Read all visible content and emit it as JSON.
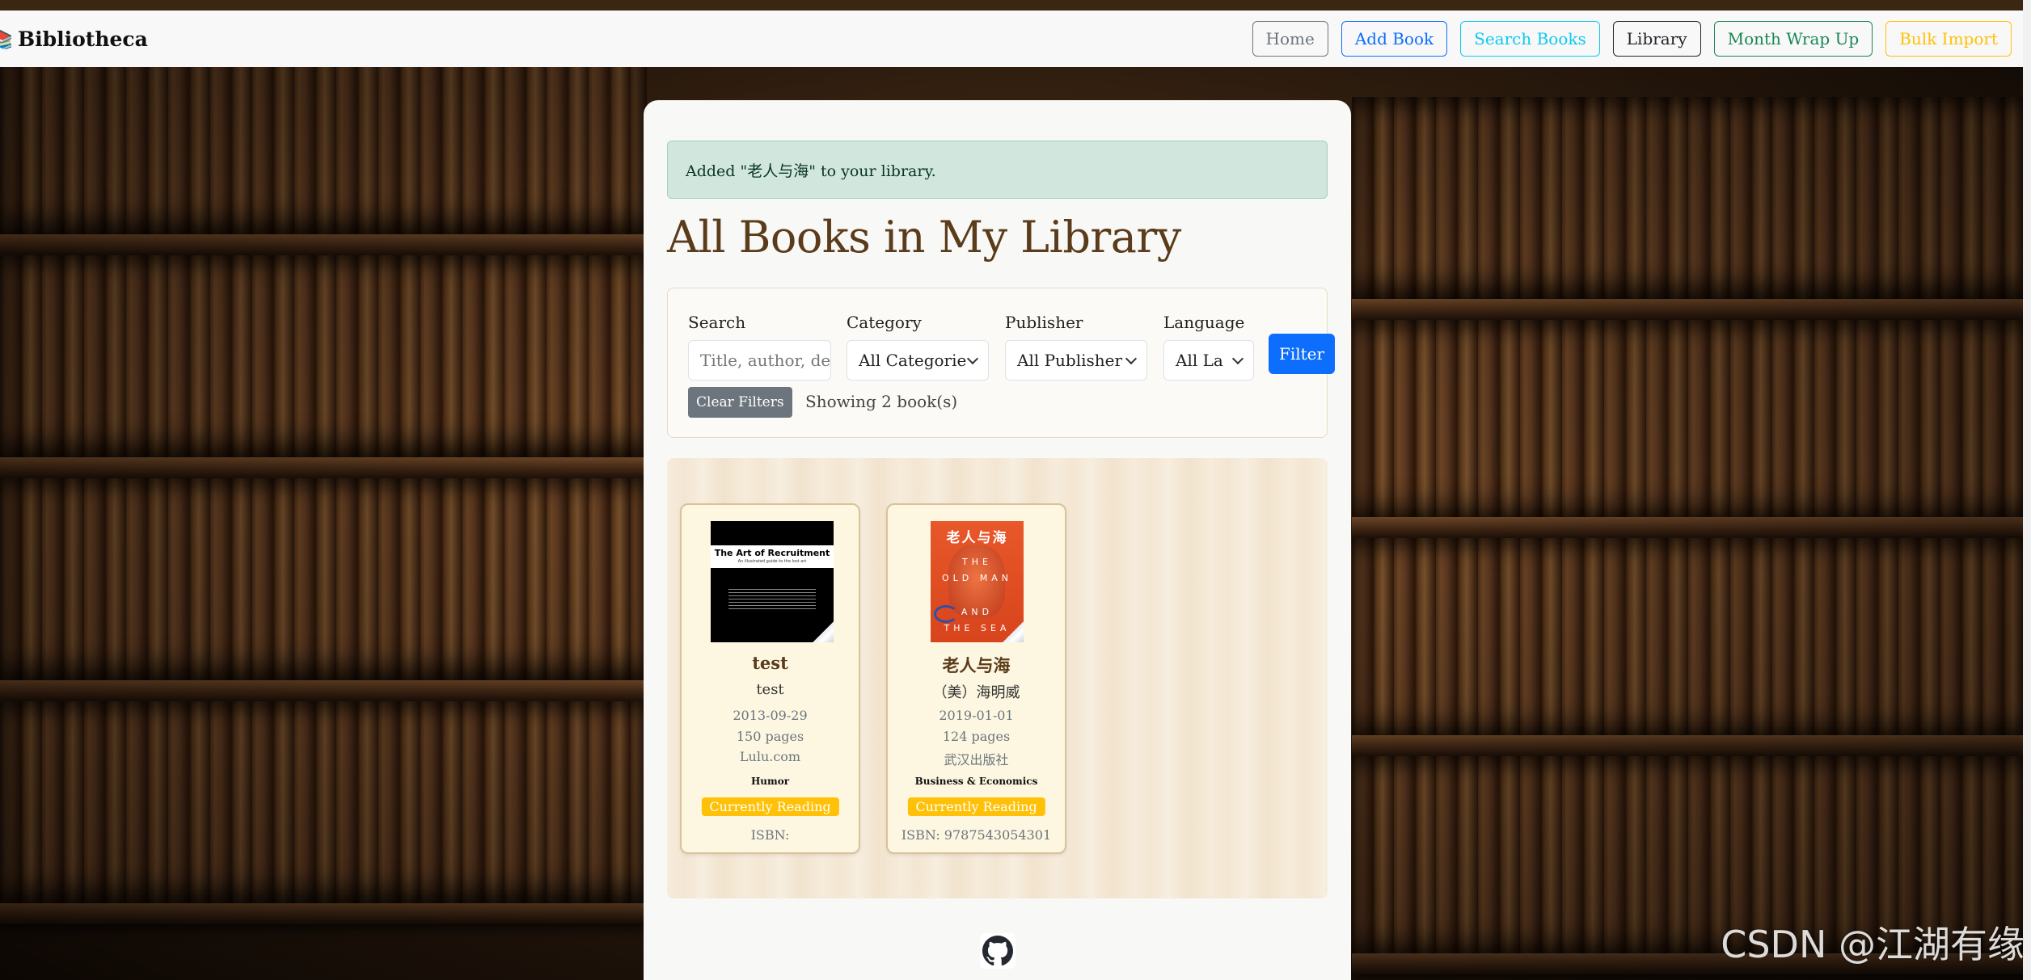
{
  "brand": {
    "name": "Bibliotheca"
  },
  "nav": {
    "home": "Home",
    "add_book": "Add Book",
    "search_books": "Search Books",
    "library": "Library",
    "month_wrap_up": "Month Wrap Up",
    "bulk_import": "Bulk Import"
  },
  "alert": {
    "message": "Added \"老人与海\" to your library."
  },
  "page": {
    "title": "All Books in My Library"
  },
  "filters": {
    "search": {
      "label": "Search",
      "placeholder": "Title, author, de:"
    },
    "category": {
      "label": "Category",
      "selected": "All Categorie"
    },
    "publisher": {
      "label": "Publisher",
      "selected": "All Publisher"
    },
    "language": {
      "label": "Language",
      "selected": "All La"
    },
    "filter_button": "Filter",
    "clear_button": "Clear Filters",
    "showing": "Showing 2 book(s)"
  },
  "books": [
    {
      "title": "test",
      "author": "test",
      "date": "2013-09-29",
      "pages": "150 pages",
      "publisher": "Lulu.com",
      "category": "Humor",
      "status": "Currently Reading",
      "isbn": "ISBN:",
      "cover": {
        "title": "The Art of Recruitment",
        "subtitle": "An illustrated guide to the lost art"
      }
    },
    {
      "title": "老人与海",
      "author": "（美）海明威",
      "date": "2019-01-01",
      "pages": "124 pages",
      "publisher": "武汉出版社",
      "category": "Business & Economics",
      "status": "Currently Reading",
      "isbn": "ISBN: 9787543054301",
      "cover": {
        "title_cn": "老人与海",
        "line1": "THE",
        "line2": "OLD MAN",
        "line3": "AND",
        "line4": "THE SEA"
      }
    }
  ],
  "watermark": "CSDN @江湖有缘",
  "colors": {
    "accent_primary": "#0d6efd",
    "status_warning": "#ffc107",
    "title_brown": "#5a3b1a",
    "alert_bg": "#d1e7dd"
  },
  "icons": {
    "footer": "github-icon",
    "select": "chevron-down-icon"
  }
}
